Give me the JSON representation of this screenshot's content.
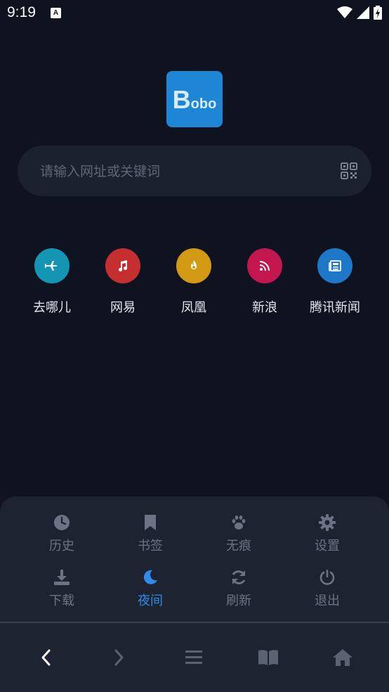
{
  "status_bar": {
    "time": "9:19",
    "notification_glyph": "A"
  },
  "logo": {
    "text_big": "B",
    "text_small": "obo"
  },
  "search": {
    "placeholder": "请输入网址或关键词"
  },
  "quick_links": [
    {
      "label": "去哪儿",
      "icon": "airplane-icon",
      "color": "#1495b3"
    },
    {
      "label": "网易",
      "icon": "music-note-icon",
      "color": "#c52f2f"
    },
    {
      "label": "凤凰",
      "icon": "fire-icon",
      "color": "#d19a12"
    },
    {
      "label": "新浪",
      "icon": "rss-icon",
      "color": "#c4164f"
    },
    {
      "label": "腾讯新闻",
      "icon": "newspaper-icon",
      "color": "#1e78c8"
    }
  ],
  "menu": {
    "history": "历史",
    "bookmarks": "书签",
    "incognito": "无痕",
    "settings": "设置",
    "download": "下载",
    "night": "夜间",
    "refresh": "刷新",
    "exit": "退出"
  },
  "colors": {
    "background": "#0f1320",
    "panel": "#1e2331",
    "accent": "#2f8ce8",
    "muted_icon": "#6c7384"
  }
}
